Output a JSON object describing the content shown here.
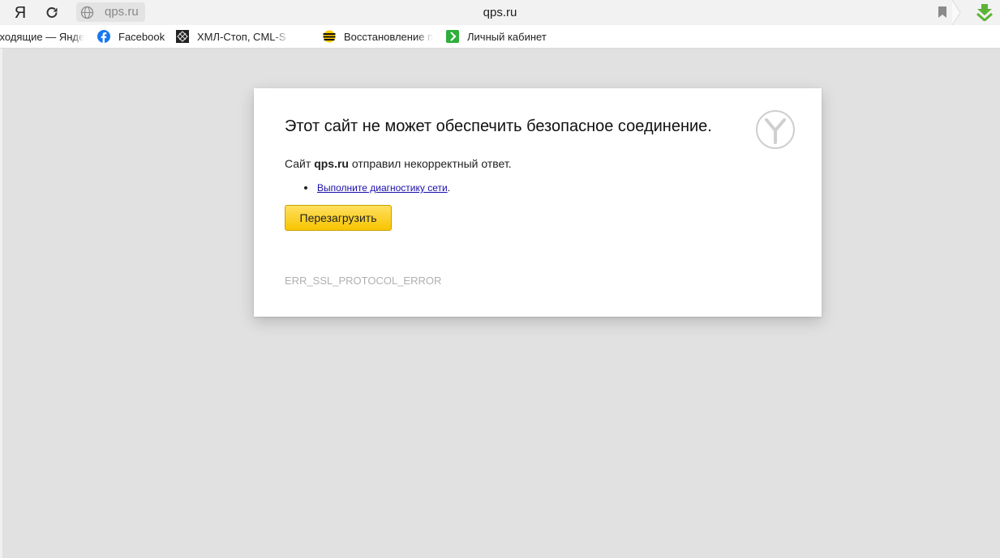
{
  "browser": {
    "logo_letter": "Я",
    "address_chip_text": "qps.ru",
    "page_title": "qps.ru"
  },
  "bookmarks": [
    {
      "label": "Входящие — Яндекс",
      "icon": "mail-icon"
    },
    {
      "label": "Facebook",
      "icon": "facebook-icon"
    },
    {
      "label": "ХМЛ-Стоп, CML-S",
      "icon": "xml-stop-icon"
    },
    {
      "label": "Восстановление п",
      "icon": "beeline-icon"
    },
    {
      "label": "Личный кабинет",
      "icon": "green-arrow-icon"
    }
  ],
  "error_page": {
    "heading": "Этот сайт не может обеспечить безопасное соединение.",
    "message_prefix": "Сайт ",
    "site": "qps.ru",
    "message_suffix": " отправил некорректный ответ.",
    "suggestion_link": "Выполните диагностику сети",
    "suggestion_tail": ".",
    "reload_button": "Перезагрузить",
    "error_code": "ERR_SSL_PROTOCOL_ERROR"
  },
  "colors": {
    "page_background": "#e1e1e1",
    "button_yellow": "#ffdb4d",
    "link": "#1a0dab",
    "download_green": "#5cb335"
  }
}
